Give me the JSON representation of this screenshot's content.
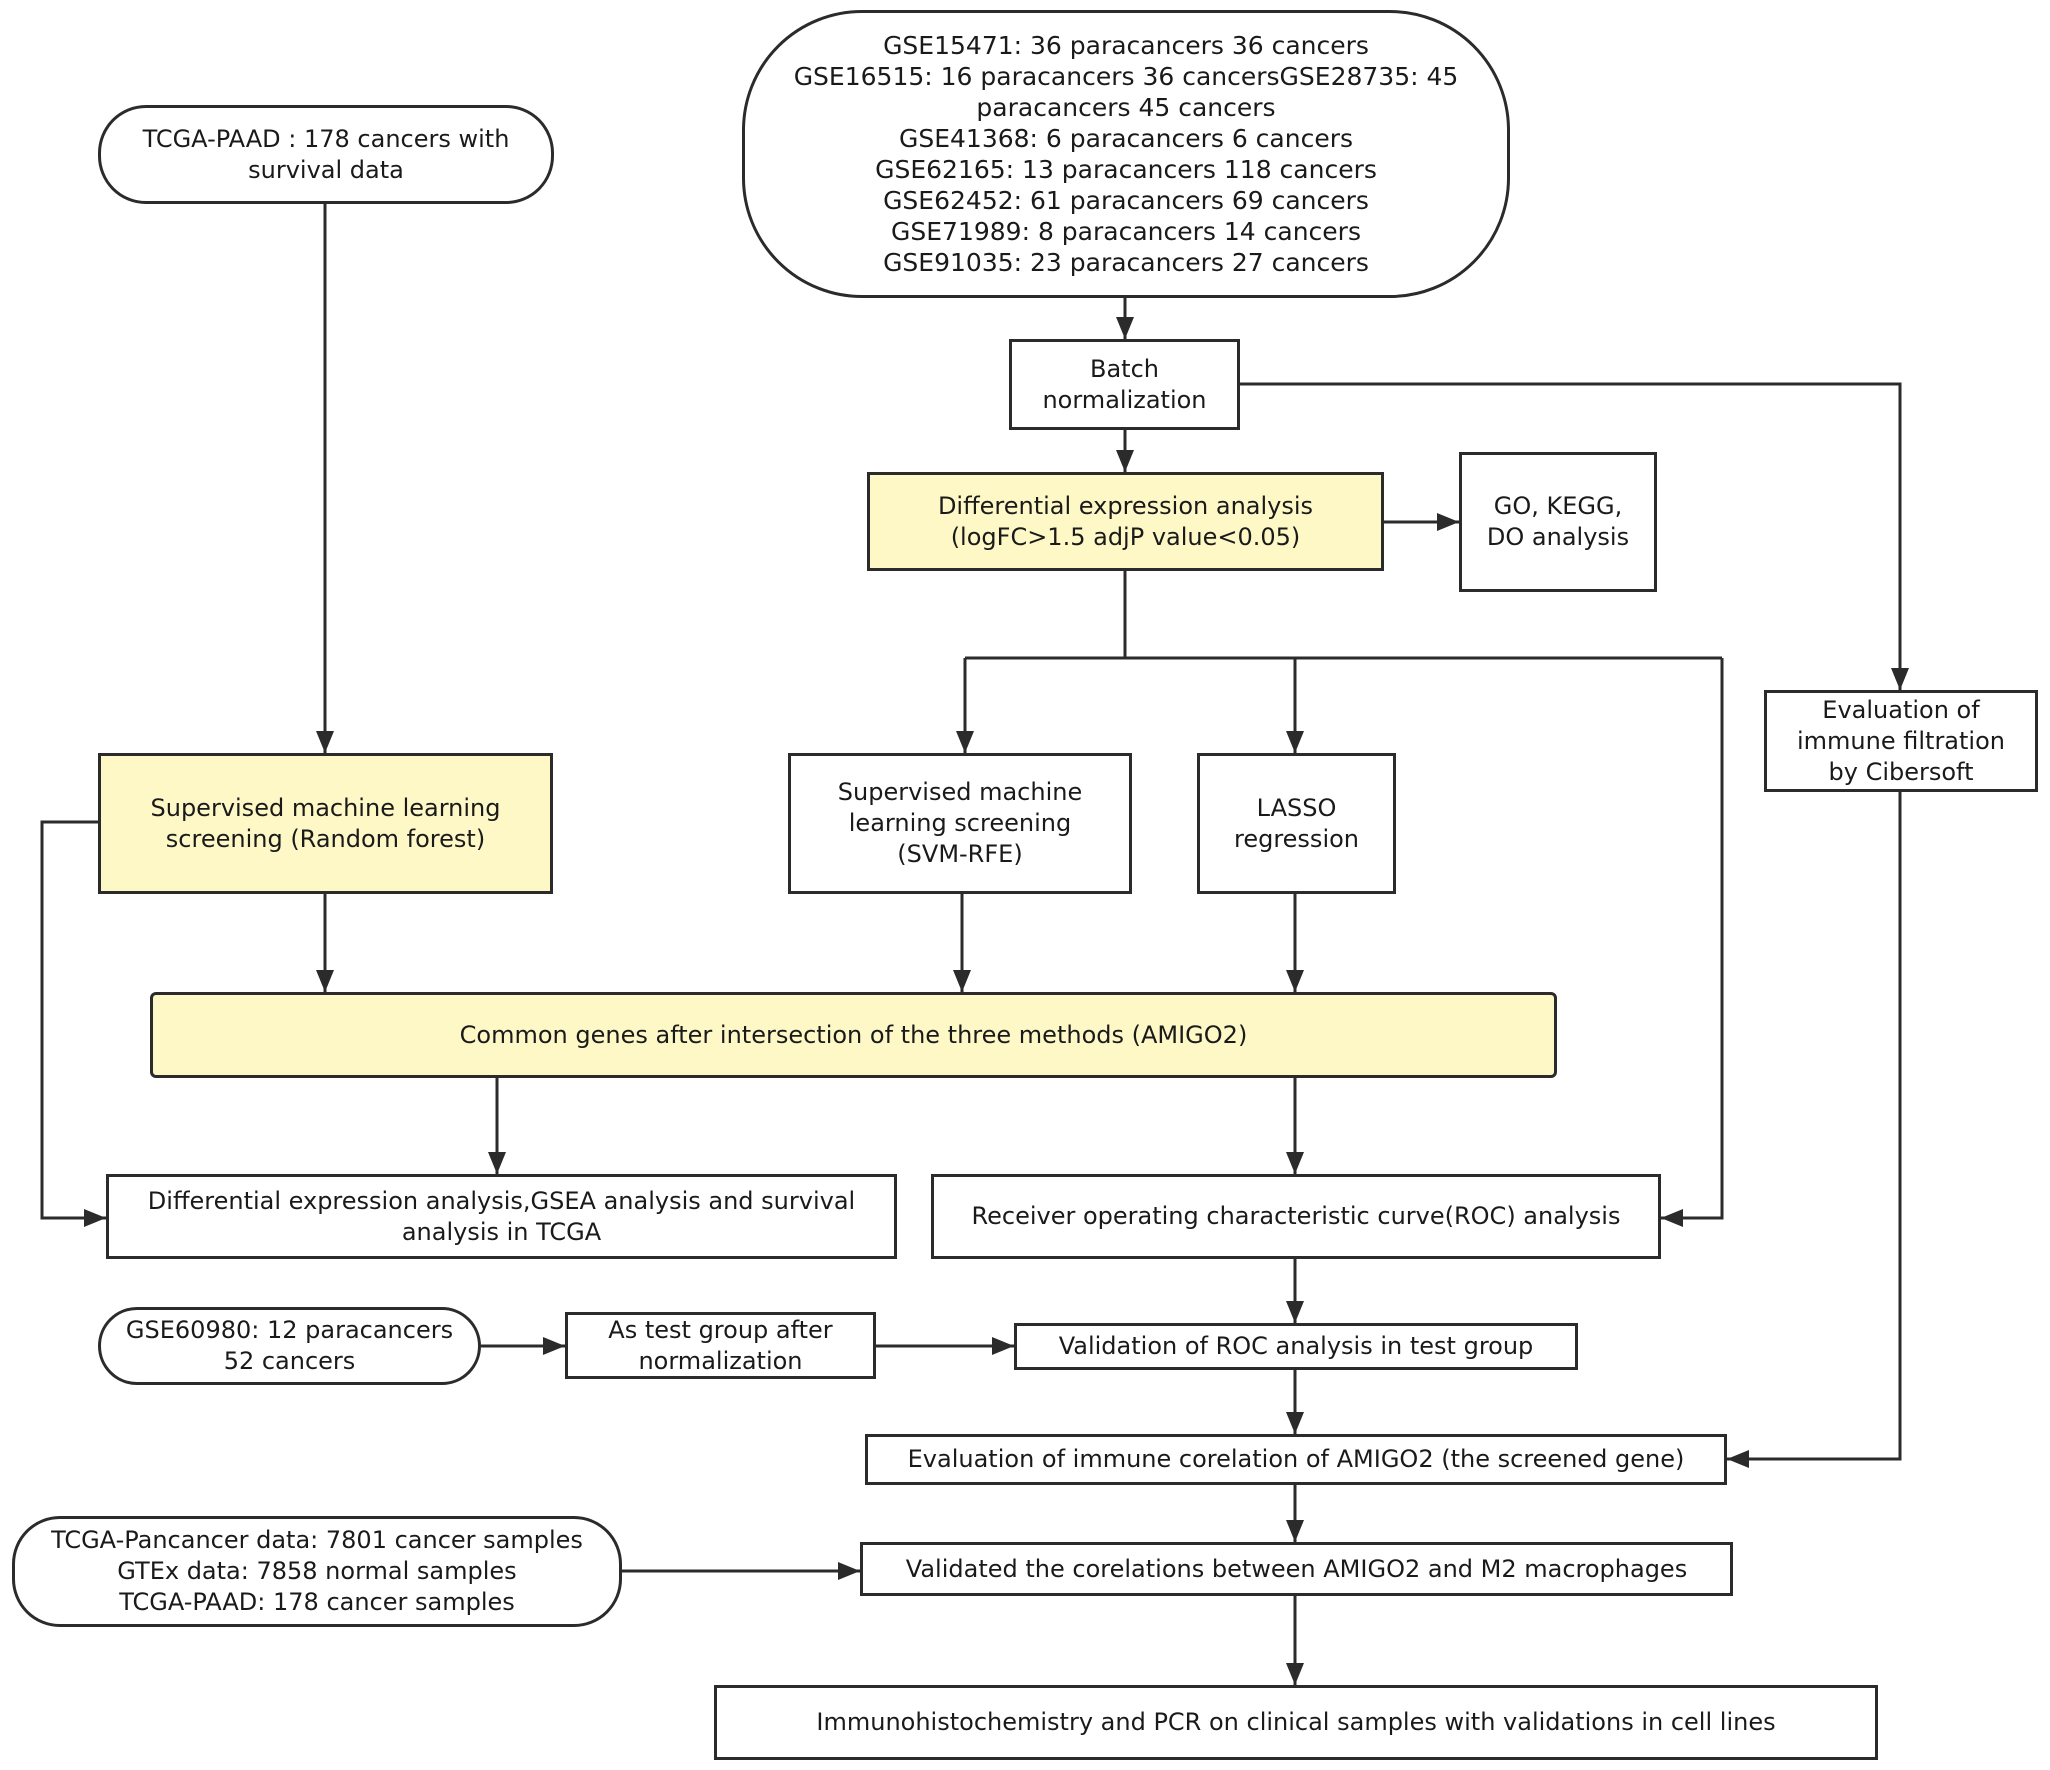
{
  "diagram": {
    "type": "flowchart",
    "colors": {
      "stroke": "#2b2b2b",
      "highlight_fill": "#fdf8c6",
      "default_fill": "#ffffff"
    },
    "nodes": {
      "tcga_paad": {
        "text": "TCGA-PAAD : 178 cancers with\nsurvival data",
        "shape": "pill"
      },
      "geo_datasets": {
        "text": "GSE15471:  36 paracancers 36 cancers\nGSE16515: 16 paracancers 36 cancersGSE28735: 45\nparacancers 45 cancers\nGSE41368: 6 paracancers 6 cancers\nGSE62165: 13 paracancers 118 cancers\nGSE62452:  61 paracancers 69 cancers\nGSE71989: 8 paracancers 14 cancers\nGSE91035: 23 paracancers 27 cancers",
        "shape": "rounded-large"
      },
      "batch_normalization": {
        "text": "Batch\nnormalization",
        "shape": "rect"
      },
      "differential_expression": {
        "text": "Differential expression analysis\n(logFC>1.5 adjP value<0.05)",
        "shape": "rect",
        "highlight": true
      },
      "go_kegg_do": {
        "text": "GO, KEGG,\nDO analysis",
        "shape": "rect"
      },
      "random_forest": {
        "text": "Supervised machine learning\nscreening (Random forest)",
        "shape": "rect",
        "highlight": true
      },
      "svm_rfe": {
        "text": "Supervised machine\nlearning screening\n(SVM-RFE)",
        "shape": "rect"
      },
      "lasso": {
        "text": "LASSO\nregression",
        "shape": "rect"
      },
      "immune_filtration": {
        "text": "Evaluation of\nimmune filtration\nby Cibersoft",
        "shape": "rect"
      },
      "common_genes": {
        "text": "Common genes after intersection of the three methods (AMIGO2)",
        "shape": "rect",
        "highlight": true
      },
      "dea_gsea_survival": {
        "text": "Differential expression analysis,GSEA analysis and survival\nanalysis in TCGA",
        "shape": "rect"
      },
      "roc_analysis": {
        "text": "Receiver operating characteristic curve(ROC) analysis",
        "shape": "rect"
      },
      "gse60980": {
        "text": "GSE60980: 12 paracancers\n52 cancers",
        "shape": "pill"
      },
      "test_group": {
        "text": "As test group after\nnormalization",
        "shape": "rect"
      },
      "roc_validation": {
        "text": "Validation of ROC analysis in test group",
        "shape": "rect"
      },
      "immune_correlation": {
        "text": "Evaluation of immune corelation of AMIGO2 (the screened gene)",
        "shape": "rect"
      },
      "pancancer_data": {
        "text": "TCGA-Pancancer data: 7801 cancer samples\nGTEx data: 7858 normal samples\nTCGA-PAAD: 178 cancer samples",
        "shape": "pill"
      },
      "m2_validation": {
        "text": "Validated the corelations between AMIGO2 and M2 macrophages",
        "shape": "rect"
      },
      "ihc_pcr": {
        "text": "Immunohistochemistry and PCR on clinical samples with validations in cell lines",
        "shape": "rect"
      }
    },
    "edges": [
      {
        "from": "tcga_paad",
        "to": "random_forest"
      },
      {
        "from": "geo_datasets",
        "to": "batch_normalization"
      },
      {
        "from": "batch_normalization",
        "to": "differential_expression"
      },
      {
        "from": "batch_normalization",
        "to": "immune_filtration"
      },
      {
        "from": "differential_expression",
        "to": "go_kegg_do"
      },
      {
        "from": "differential_expression",
        "to": "svm_rfe"
      },
      {
        "from": "differential_expression",
        "to": "lasso"
      },
      {
        "from": "differential_expression",
        "to": "roc_analysis"
      },
      {
        "from": "random_forest",
        "to": "common_genes"
      },
      {
        "from": "random_forest",
        "to": "dea_gsea_survival"
      },
      {
        "from": "svm_rfe",
        "to": "common_genes"
      },
      {
        "from": "lasso",
        "to": "common_genes"
      },
      {
        "from": "common_genes",
        "to": "dea_gsea_survival"
      },
      {
        "from": "common_genes",
        "to": "roc_analysis"
      },
      {
        "from": "roc_analysis",
        "to": "roc_validation"
      },
      {
        "from": "gse60980",
        "to": "test_group"
      },
      {
        "from": "test_group",
        "to": "roc_validation"
      },
      {
        "from": "roc_validation",
        "to": "immune_correlation"
      },
      {
        "from": "immune_filtration",
        "to": "immune_correlation"
      },
      {
        "from": "immune_correlation",
        "to": "m2_validation"
      },
      {
        "from": "pancancer_data",
        "to": "m2_validation"
      },
      {
        "from": "m2_validation",
        "to": "ihc_pcr"
      }
    ]
  }
}
